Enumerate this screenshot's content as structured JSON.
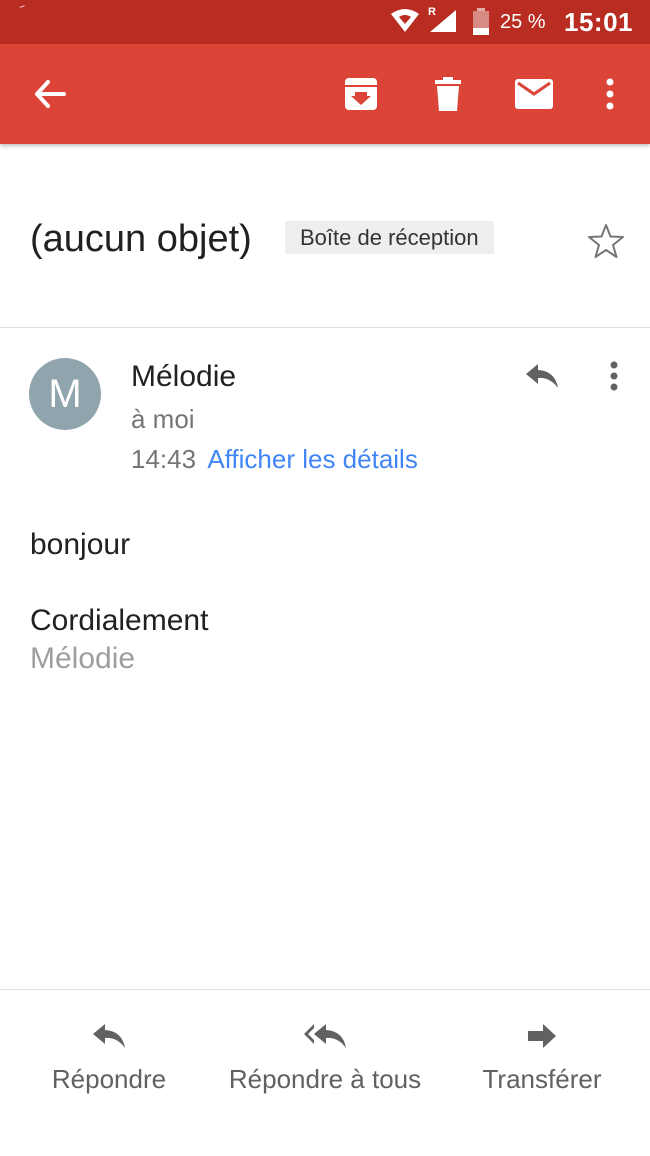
{
  "status_bar": {
    "battery_percent": "25 %",
    "time": "15:01",
    "network_badge": "R",
    "icons": [
      "wifi-icon",
      "signal-icon",
      "battery-icon"
    ]
  },
  "toolbar": {
    "icons": [
      "back-arrow-icon",
      "archive-icon",
      "delete-icon",
      "mark-unread-icon",
      "more-vert-icon"
    ],
    "accent_color": "#db4437",
    "status_color": "#b92c21"
  },
  "email": {
    "subject": "(aucun objet)",
    "label": "Boîte de réception",
    "sender_initial": "M",
    "sender_name": "Mélodie",
    "recipient": "à moi",
    "time": "14:43",
    "details_link": "Afficher les détails",
    "avatar_color": "#90a4ae",
    "link_color": "#4285f4",
    "body": {
      "greeting": "bonjour",
      "closing": "Cordialement",
      "signature": "Mélodie"
    }
  },
  "actions": {
    "reply": "Répondre",
    "reply_all": "Répondre à tous",
    "forward": "Transférer"
  }
}
